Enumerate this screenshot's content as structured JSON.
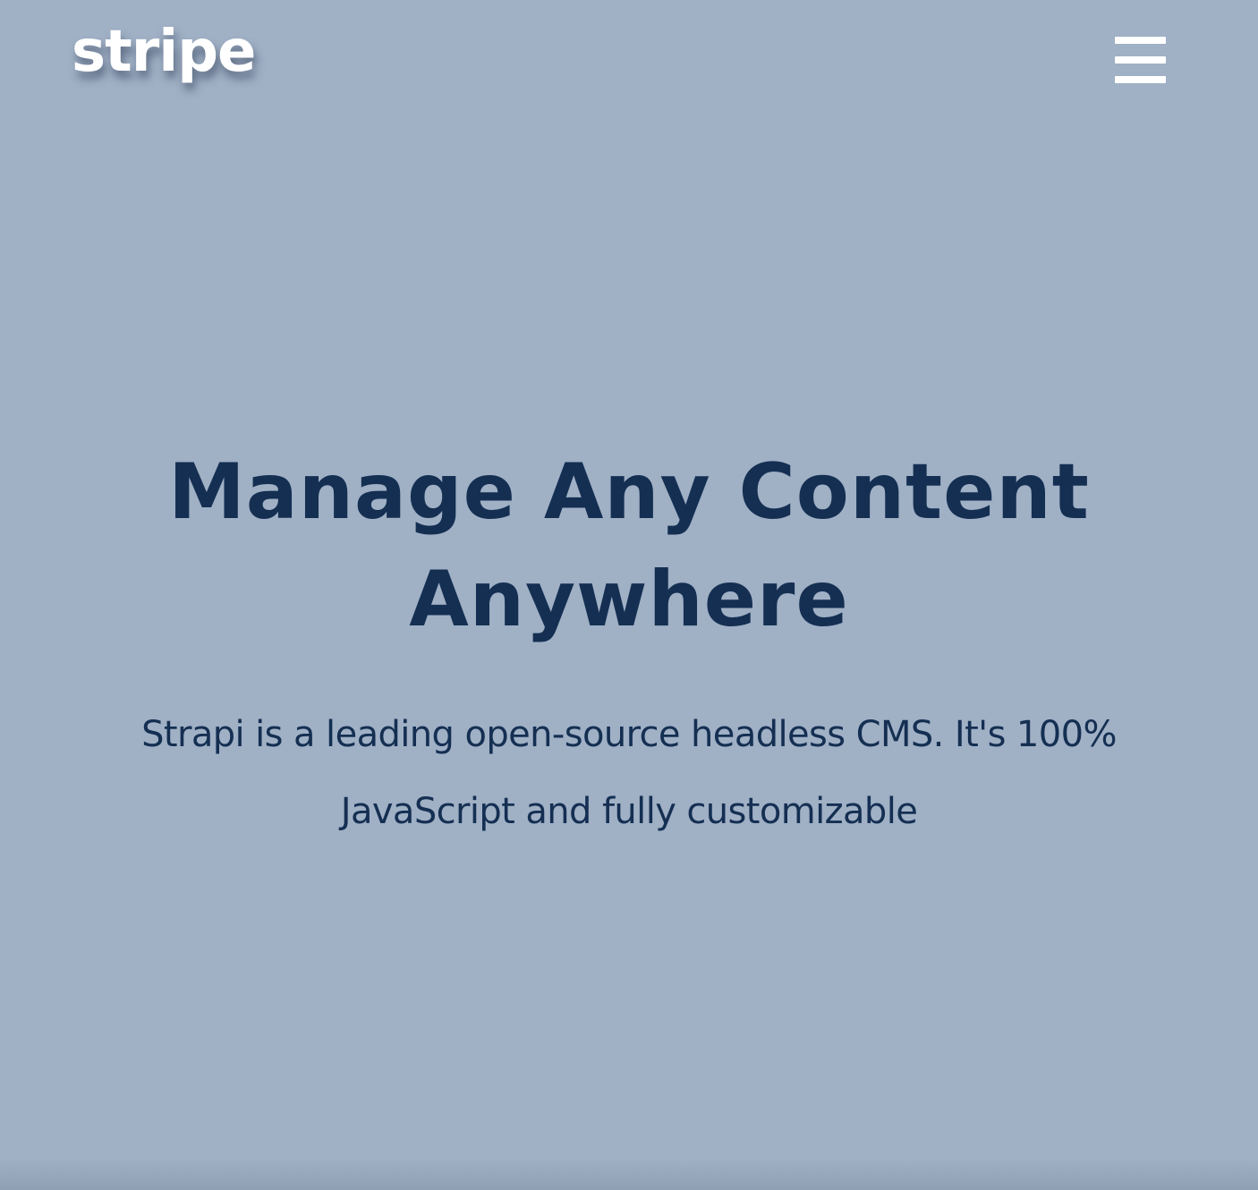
{
  "header": {
    "logo_text": "stripe",
    "menu_icon": "hamburger-menu-icon"
  },
  "hero": {
    "title": "Manage Any Content Anywhere",
    "subtitle": "Strapi is a leading open-source headless CMS. It's 100% JavaScript and fully customizable"
  },
  "colors": {
    "background": "#a0b0c5",
    "heading": "#142f52",
    "logo": "#ffffff"
  }
}
